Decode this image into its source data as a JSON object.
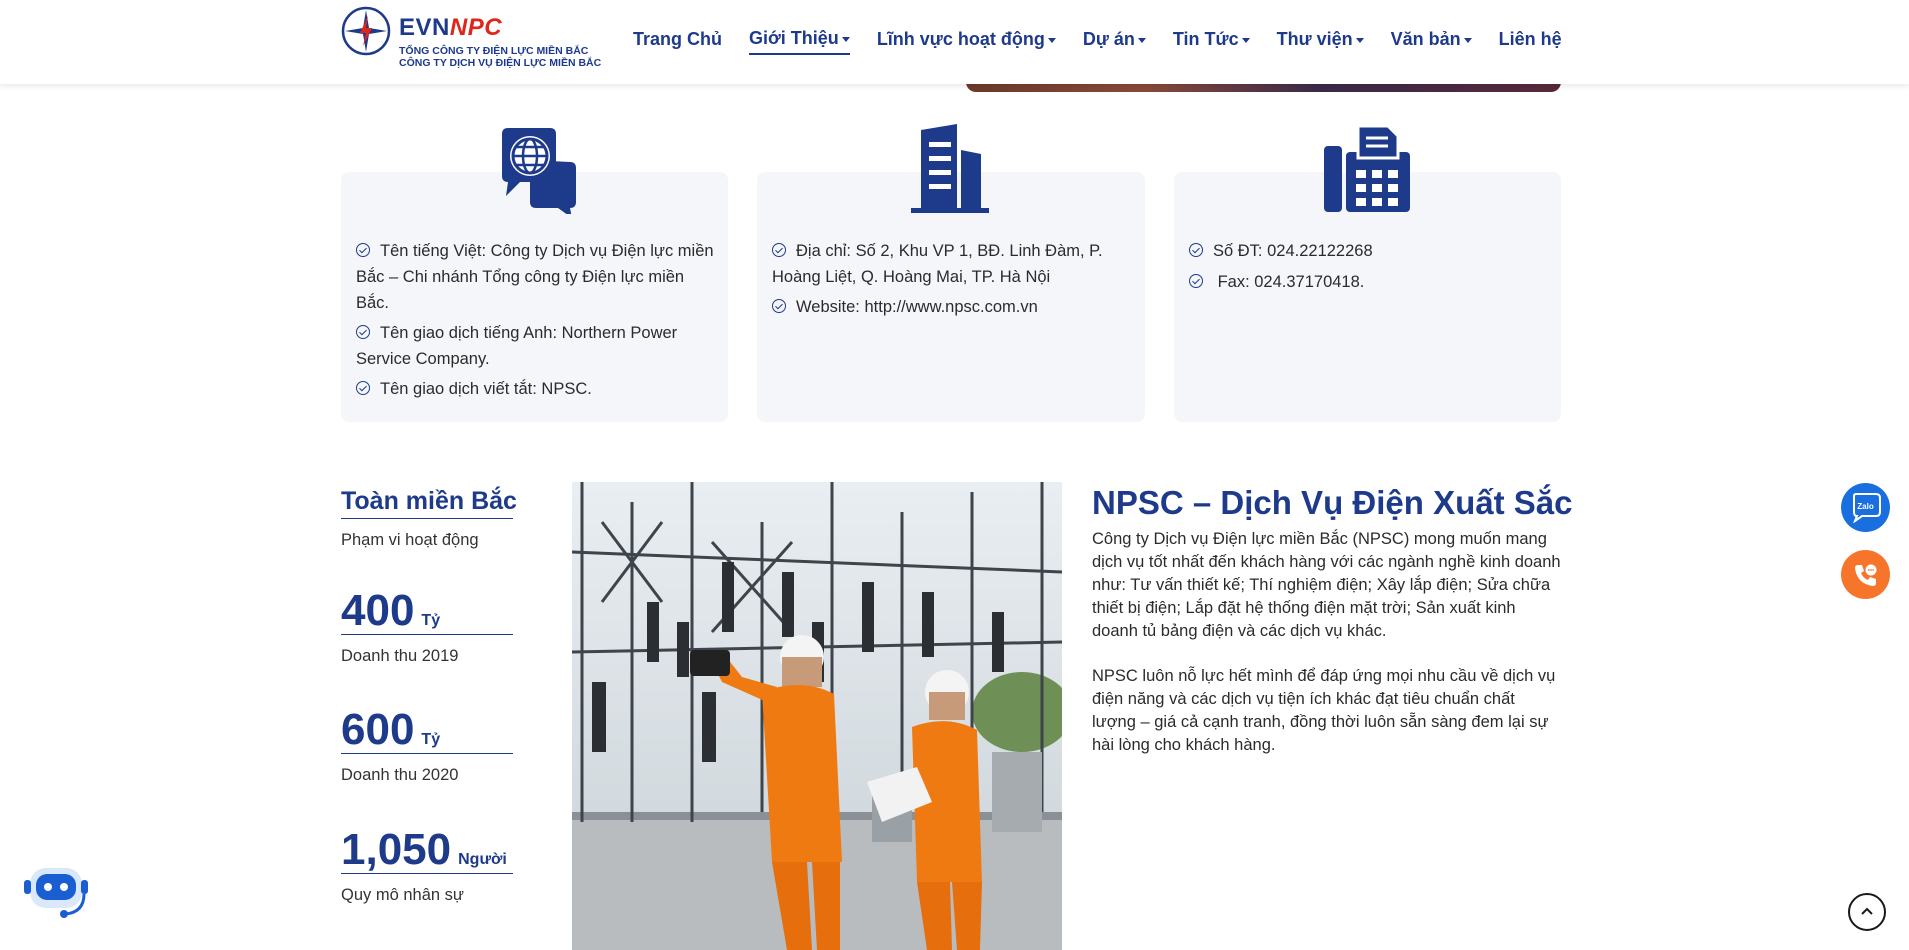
{
  "header": {
    "brand_main": "EVN",
    "brand_accent": "NPC",
    "subtitle_line1": "TỔNG CÔNG TY ĐIỆN LỰC MIỀN BẮC",
    "subtitle_line2": "CÔNG TY DỊCH VỤ ĐIỆN LỰC MIỀN BẮC"
  },
  "nav": {
    "items": [
      {
        "label": "Trang Chủ"
      },
      {
        "label": "Giới Thiệu"
      },
      {
        "label": "Lĩnh vực hoạt động"
      },
      {
        "label": "Dự án"
      },
      {
        "label": "Tin Tức"
      },
      {
        "label": "Thư viện"
      },
      {
        "label": "Văn bản"
      },
      {
        "label": "Liên hệ"
      }
    ],
    "active": "Giới Thiệu"
  },
  "cards": {
    "name": {
      "icon": "globe-chat-icon",
      "items": [
        "Tên tiếng Việt: Công ty Dịch vụ Điện lực miền Bắc – Chi nhánh Tổng công ty Điện lực miền Bắc.",
        "Tên giao dịch tiếng Anh: Northern Power Service Company.",
        "Tên giao dịch viết tắt: NPSC."
      ]
    },
    "address": {
      "icon": "building-icon",
      "items": [
        "Địa chỉ: Số 2, Khu VP 1, BĐ. Linh Đàm, P. Hoàng Liệt, Q. Hoàng Mai, TP. Hà Nội",
        "Website: http://www.npsc.com.vn"
      ]
    },
    "contact": {
      "icon": "fax-icon",
      "items": [
        "Số ĐT: 024.22122268",
        " Fax: 024.37170418."
      ]
    }
  },
  "stats": [
    {
      "value": "Toàn miền Bắc",
      "unit": "",
      "label": "Phạm vi hoạt động"
    },
    {
      "value": "400",
      "unit": "Tỷ",
      "label": "Doanh thu 2019"
    },
    {
      "value": "600",
      "unit": "Tỷ",
      "label": "Doanh thu 2020"
    },
    {
      "value": "1,050",
      "unit": "Người",
      "label": "Quy mô nhân sự"
    }
  ],
  "about": {
    "title": "NPSC – Dịch Vụ Điện Xuất Sắc",
    "p1": "Công ty Dịch vụ Điện lực miền Bắc (NPSC) mong muốn mang dịch vụ tốt nhất đến khách hàng với các ngành nghề kinh doanh như: Tư vấn thiết kế; Thí nghiệm điện; Xây lắp điện; Sửa chữa thiết bị điện; Lắp đặt hệ thống điện mặt trời; Sản xuất kinh doanh tủ bảng điện và các dịch vụ khác.",
    "p2": "NPSC luôn nỗ lực hết mình để đáp ứng mọi nhu cầu về dịch vụ điện năng và các dịch vụ tiện ích khác đạt tiêu chuẩn chất lượng – giá cả cạnh tranh, đồng thời luôn sẵn sàng đem lại sự hài lòng cho khách hàng."
  },
  "floating": {
    "zalo_label": "Zalo"
  },
  "colors": {
    "primary": "#1e3a8a",
    "accent_red": "#e0261b",
    "zalo": "#1a6fe0",
    "phone": "#f7752b",
    "card_bg": "#f4f6fa"
  }
}
